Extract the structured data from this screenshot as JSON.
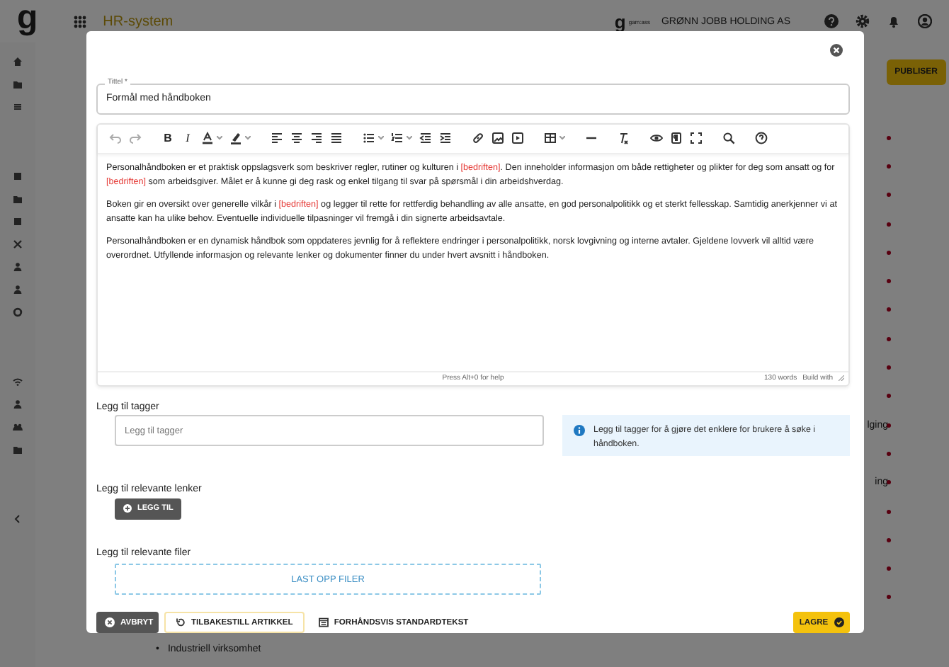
{
  "app": {
    "logo": "g",
    "title": "HR-system",
    "company_logo": "g",
    "company_tag": "gam:ass",
    "company": "GRØNN JOBB HOLDING AS",
    "publish_button": "PUBLISER",
    "side_fragments": [
      "lging",
      "ing"
    ],
    "bullet_marker": "•",
    "bullet_text": "Industriell virksomhet"
  },
  "dialog": {
    "title_field": {
      "label": "Tittel *",
      "value": "Formål med håndboken"
    },
    "toolbar": {
      "bold": "B",
      "italic": "I"
    },
    "paragraphs": [
      [
        {
          "kind": "text",
          "text": "Personalhåndboken er et praktisk oppslagsverk som beskriver regler, rutiner og kulturen i "
        },
        {
          "kind": "token",
          "text": "[bedriften]"
        },
        {
          "kind": "text",
          "text": ". Den inneholder informasjon om både rettigheter og plikter for deg som ansatt og for "
        },
        {
          "kind": "token",
          "text": "[bedriften]"
        },
        {
          "kind": "text",
          "text": " som arbeidsgiver. Målet er å kunne gi deg rask og enkel tilgang til svar på spørsmål i din arbeidshverdag."
        }
      ],
      [
        {
          "kind": "text",
          "text": "Boken gir en oversikt over generelle vilkår i "
        },
        {
          "kind": "token",
          "text": "[bedriften]"
        },
        {
          "kind": "text",
          "text": " og legger til rette for rettferdig behandling av alle ansatte, en god personalpolitikk og et sterkt fellesskap. Samtidig anerkjenner vi at ansatte kan ha ulike behov. Eventuelle individuelle tilpasninger vil fremgå i din signerte arbeidsavtale."
        }
      ],
      [
        {
          "kind": "text",
          "text": "Personalhåndboken er en dynamisk håndbok som oppdateres jevnlig for å reflektere endringer i personalpolitikk, norsk lovgivning og interne avtaler. Gjeldene lovverk vil alltid være overordnet. Utfyllende informasjon og relevante lenker og dokumenter finner du under hvert avsnitt i håndboken."
        }
      ]
    ],
    "status": {
      "help": "Press Alt+0 for help",
      "words": "130 words",
      "brand": "Build with"
    },
    "tags": {
      "label": "Legg til tagger",
      "placeholder": "Legg til tagger",
      "info": "Legg til tagger for å gjøre det enklere for brukere å søke i håndboken."
    },
    "links": {
      "label": "Legg til relevante lenker",
      "button": "LEGG TIL"
    },
    "files": {
      "label": "Legg til relevante filer",
      "upload": "LAST OPP FILER"
    },
    "footer": {
      "cancel": "AVBRYT",
      "reset": "TILBAKESTILL ARTIKKEL",
      "preview": "FORHÅNDSVIS STANDARDTEKST",
      "save": "LAGRE"
    }
  }
}
